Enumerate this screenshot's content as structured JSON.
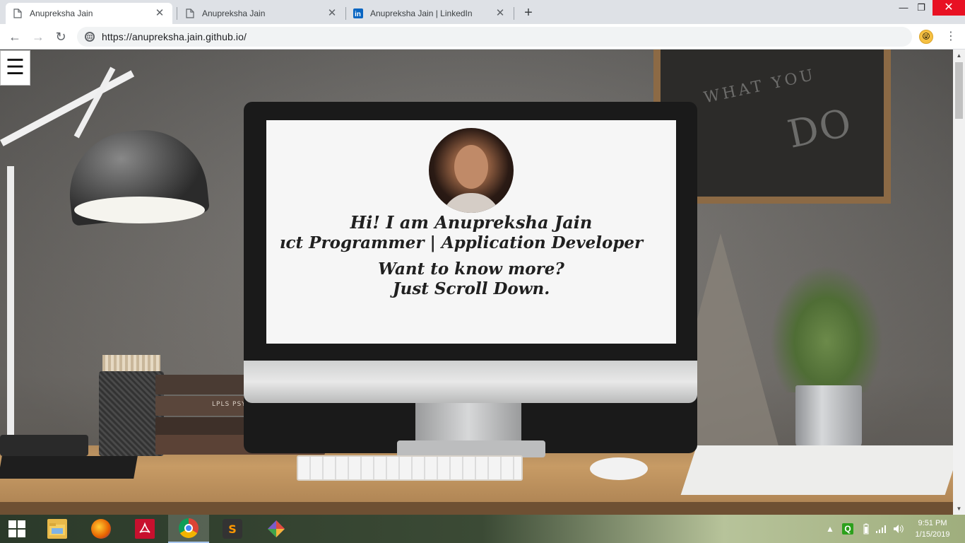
{
  "browser": {
    "tabs": [
      {
        "title": "Anupreksha Jain",
        "active": true,
        "icon": "page-icon"
      },
      {
        "title": "Anupreksha Jain",
        "active": false,
        "icon": "page-icon"
      },
      {
        "title": "Anupreksha Jain | LinkedIn",
        "active": false,
        "icon": "linkedin-icon"
      }
    ],
    "new_tab_label": "+",
    "window_controls": {
      "minimize": "—",
      "restore": "❐",
      "close": "✕"
    },
    "nav": {
      "back": "←",
      "forward": "→",
      "reload": "↻"
    },
    "url": "https://anupreksha.jain.github.io/",
    "menu_label": "⋮"
  },
  "page": {
    "menu_label": "☰",
    "greeting": "Hi! I am Anupreksha Jain",
    "roles": "ıct Programmer | Application Developer",
    "ask": "Want to know more?",
    "scroll_hint": "Just Scroll Down.",
    "chalkboard_text": "WHAT YOU",
    "chalkboard_text_big": "DO",
    "book_label": "LPLS   PSYCHOLOGY"
  },
  "taskbar": {
    "apps": [
      {
        "name": "file-explorer",
        "color": "#e8b94a"
      },
      {
        "name": "firefox",
        "color": "#e66000"
      },
      {
        "name": "acrobat",
        "color": "#c8102e"
      },
      {
        "name": "chrome",
        "color": "#4285f4",
        "active": true
      },
      {
        "name": "sublime-text",
        "color": "#ff9800"
      },
      {
        "name": "git-extensions",
        "color": "#7a5cc8"
      }
    ],
    "tray_icons": [
      "chevron-up-icon",
      "quickbooks-icon",
      "battery-icon",
      "wifi-icon",
      "volume-icon"
    ],
    "quickbooks_label": "Q",
    "time": "9:51 PM",
    "date": "1/15/2019"
  },
  "colors": {
    "close_button": "#e81123",
    "linkedin": "#0a66c2",
    "screen_text": "#202020"
  }
}
